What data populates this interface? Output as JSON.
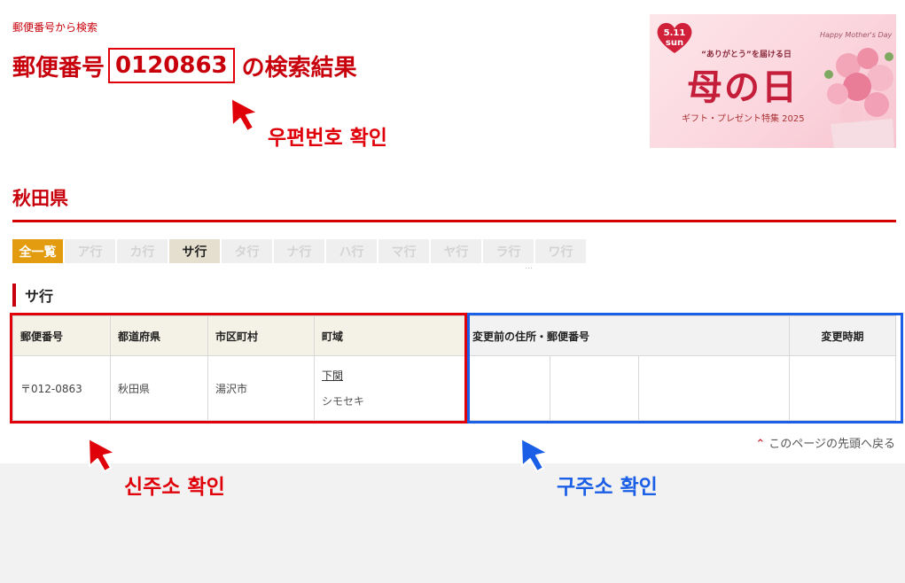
{
  "breadcrumb": "郵便番号から検索",
  "title": {
    "prefix": "郵便番号",
    "zip": "0120863",
    "suffix": "の検索結果"
  },
  "banner": {
    "date": "5.11",
    "day": "sun",
    "script": "Happy Mother's Day",
    "subtitle": "“ありがとう”を届ける日",
    "main": "母の日",
    "tagline": "ギフト・プレゼント特集 2025"
  },
  "prefecture": "秋田県",
  "tabs": [
    {
      "label": "全一覧",
      "state": "all"
    },
    {
      "label": "ア行",
      "state": "disabled"
    },
    {
      "label": "カ行",
      "state": "disabled"
    },
    {
      "label": "サ行",
      "state": "active"
    },
    {
      "label": "タ行",
      "state": "disabled"
    },
    {
      "label": "ナ行",
      "state": "disabled"
    },
    {
      "label": "ハ行",
      "state": "disabled"
    },
    {
      "label": "マ行",
      "state": "disabled"
    },
    {
      "label": "ヤ行",
      "state": "disabled"
    },
    {
      "label": "ラ行",
      "state": "disabled"
    },
    {
      "label": "ワ行",
      "state": "disabled"
    }
  ],
  "tabs_more": "…",
  "section_heading": "サ行",
  "table": {
    "headers": {
      "zip": "郵便番号",
      "prefecture": "都道府県",
      "city": "市区町村",
      "town": "町域",
      "previous": "変更前の住所・郵便番号",
      "changed_at": "変更時期"
    },
    "row": {
      "zip": "〒012-0863",
      "prefecture": "秋田県",
      "city": "湯沢市",
      "town": "下関",
      "town_kana": "シモセキ",
      "prev_1": "",
      "prev_2": "",
      "prev_3": "",
      "changed_at": ""
    }
  },
  "back_to_top": "このページの先頭へ戻る",
  "annotations": {
    "zip_check": "우편번호 확인",
    "new_address": "신주소 확인",
    "old_address": "구주소 확인"
  },
  "colors": {
    "brand_red": "#c8000b",
    "annotation_red": "#e0000a",
    "annotation_blue": "#1a5fe6",
    "all_tab": "#e39c10"
  },
  "icons": {
    "cursor": "arrow-cursor-icon",
    "back_top": "chevron-up-icon"
  }
}
